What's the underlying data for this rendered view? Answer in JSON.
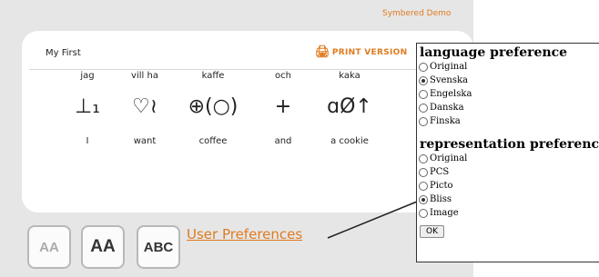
{
  "header": {
    "brand": "Symbered Demo"
  },
  "document": {
    "title": "My First",
    "print_label": "PRINT VERSION",
    "words": [
      {
        "word": "jag",
        "symbol": "⊥₁",
        "gloss": "I"
      },
      {
        "word": "vill ha",
        "symbol": "♡≀",
        "gloss": "want"
      },
      {
        "word": "kaffe",
        "symbol": "⊕(○)",
        "gloss": "coffee"
      },
      {
        "word": "och",
        "symbol": "+",
        "gloss": "and"
      },
      {
        "word": "kaka",
        "symbol": "ɑØ↑",
        "gloss": "a cookie"
      }
    ]
  },
  "toolbar": {
    "buttons": [
      {
        "label": "AA"
      },
      {
        "label": "AA"
      },
      {
        "label": "ABC"
      }
    ],
    "user_preferences": "User Preferences"
  },
  "preferences": {
    "language_heading": "language preference",
    "language_options": [
      {
        "label": "Original",
        "selected": false
      },
      {
        "label": "Svenska",
        "selected": true
      },
      {
        "label": "Engelska",
        "selected": false
      },
      {
        "label": "Danska",
        "selected": false
      },
      {
        "label": "Finska",
        "selected": false
      }
    ],
    "representation_heading": "representation preference",
    "representation_options": [
      {
        "label": "Original",
        "selected": false
      },
      {
        "label": "PCS",
        "selected": false
      },
      {
        "label": "Picto",
        "selected": false
      },
      {
        "label": "Bliss",
        "selected": true
      },
      {
        "label": "Image",
        "selected": false
      }
    ],
    "ok_label": "OK"
  }
}
